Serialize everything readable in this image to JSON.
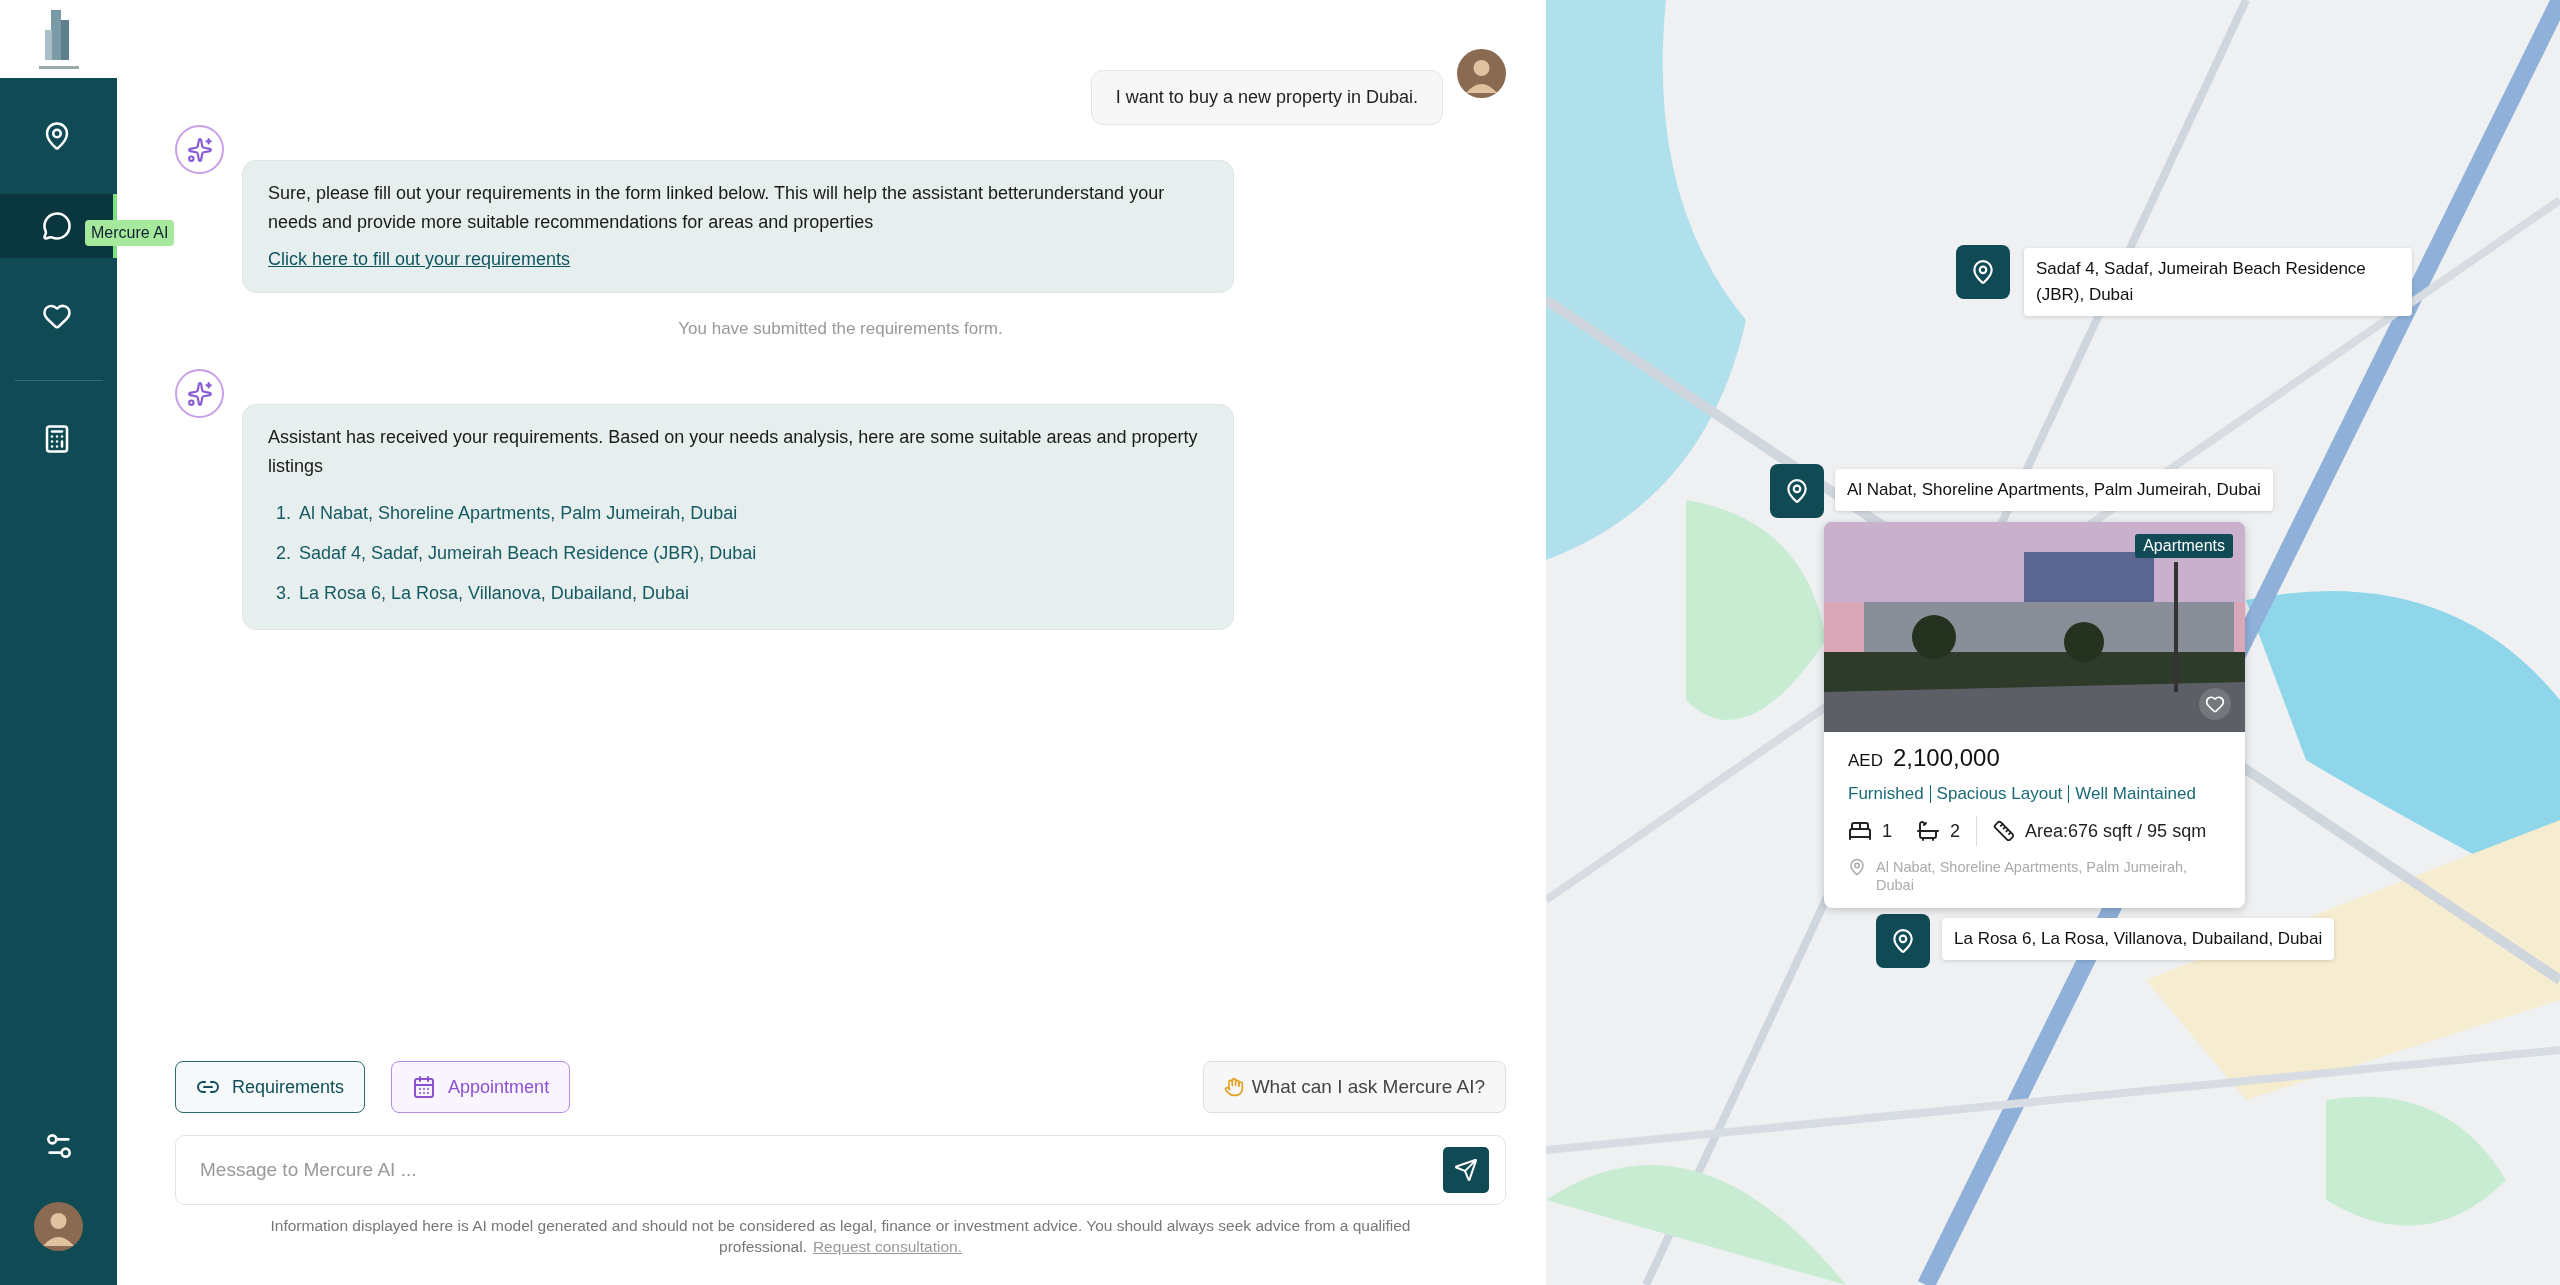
{
  "sidebar": {
    "items": [
      {
        "kind": "map",
        "selected": false
      },
      {
        "kind": "chat",
        "selected": true
      },
      {
        "kind": "favorites",
        "selected": false
      },
      {
        "kind": "calculator",
        "selected": false
      }
    ],
    "tooltip": "Mercure AI"
  },
  "messages": [
    {
      "kind": "user",
      "text": "I want to buy a new property in Dubai."
    },
    {
      "kind": "assistant",
      "text": "Sure, please fill out your requirements in the form linked below. This will help the assistant betterunderstand your needs and provide more suitable recommendations for areas and properties",
      "link": "Click here to fill out your requirements"
    },
    {
      "kind": "system",
      "text": "You have submitted the requirements form."
    },
    {
      "kind": "assistant",
      "text": "Assistant has received your requirements. Based on your needs analysis, here are some suitable areas and property listings",
      "list": [
        {
          "marker": "1.",
          "text": "Al Nabat, Shoreline Apartments, Palm Jumeirah, Dubai"
        },
        {
          "marker": "2.",
          "text": "Sadaf 4, Sadaf, Jumeirah Beach Residence (JBR), Dubai"
        },
        {
          "marker": "3.",
          "text": "La Rosa 6, La Rosa, Villanova, Dubailand, Dubai"
        }
      ]
    }
  ],
  "quick_actions": [
    {
      "kind": "requirements",
      "label": "Requirements"
    },
    {
      "kind": "appointment",
      "label": "Appointment"
    }
  ],
  "help_button": "What can I ask Mercure AI?",
  "message_input": {
    "placeholder": "Message to Mercure AI ..."
  },
  "disclaimer": {
    "text": "Information displayed here is AI model generated and should not be considered as legal, finance or investment advice. You should always seek advice from a qualified professional.",
    "link": "Request consultation."
  },
  "map": {
    "markers": [
      {
        "label": "Sadaf 4, Sadaf, Jumeirah Beach Residence (JBR), Dubai"
      },
      {
        "label": "Al Nabat, Shoreline Apartments, Palm Jumeirah, Dubai"
      },
      {
        "label": "La Rosa 6, La Rosa, Villanova, Dubailand, Dubai"
      }
    ],
    "card": {
      "tag": "Apartments",
      "currency": "AED",
      "price": "2,100,000",
      "features": [
        "Furnished",
        "Spacious Layout",
        "Well Maintained"
      ],
      "beds": "1",
      "baths": "2",
      "area": "Area:676 sqft / 95 sqm",
      "address": "Al Nabat, Shoreline Apartments, Palm Jumeirah, Dubai"
    }
  }
}
